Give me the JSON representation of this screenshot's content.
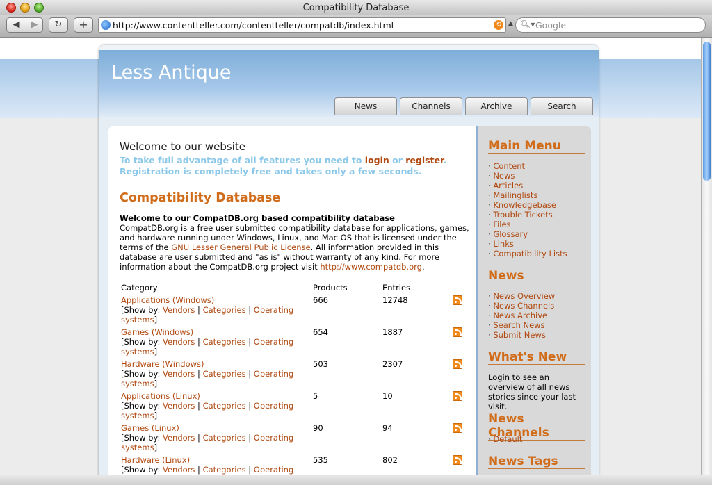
{
  "window": {
    "title": "Compatibility Database"
  },
  "toolbar": {
    "back_label": "◀",
    "forward_label": "▶",
    "reload_label": "↻",
    "add_label": "+",
    "url": "http://www.contentteller.com/contentteller/compatdb/index.html",
    "search_placeholder": "Google"
  },
  "site": {
    "logo": "Less Antique",
    "tabs": [
      "News",
      "Channels",
      "Archive",
      "Search"
    ]
  },
  "welcome": {
    "heading": "Welcome to our website",
    "line1_pre": "To take full advantage of all features you need to ",
    "login": "login",
    "or": " or ",
    "register": "register",
    "line1_post": ".",
    "line2": "Registration is completely free and takes only a few seconds."
  },
  "compat": {
    "heading": "Compatibility Database",
    "intro_bold": "Welcome to our CompatDB.org based compatibility database",
    "intro_1": "CompatDB.org is a free user submitted compatibility database for applications, games, and hardware running under Windows, Linux, and Mac OS that is licensed under the terms of the ",
    "license_link": "GNU Lesser General Public License",
    "intro_2": ". All information provided in this database are user submitted and \"as is\" without warranty of any kind. For more information about the CompatDB.org project visit ",
    "site_link": "http://www.compatdb.org",
    "intro_3": ".",
    "columns": {
      "category": "Category",
      "products": "Products",
      "entries": "Entries"
    },
    "showby_label": "[Show by: ",
    "showby_vendors": "Vendors",
    "showby_categories": "Categories",
    "showby_os": "Operating systems",
    "showby_close": "]",
    "sep": " | ",
    "rows": [
      {
        "name": "Applications (Windows)",
        "products": "666",
        "entries": "12748"
      },
      {
        "name": "Games (Windows)",
        "products": "654",
        "entries": "1887"
      },
      {
        "name": "Hardware (Windows)",
        "products": "503",
        "entries": "2307"
      },
      {
        "name": "Applications (Linux)",
        "products": "5",
        "entries": "10"
      },
      {
        "name": "Games (Linux)",
        "products": "90",
        "entries": "94"
      },
      {
        "name": "Hardware (Linux)",
        "products": "535",
        "entries": "802"
      }
    ]
  },
  "sidebar": {
    "main_menu": {
      "heading": "Main Menu",
      "items": [
        "Content",
        "News",
        "Articles",
        "Mailinglists",
        "Knowledgebase",
        "Trouble Tickets",
        "Files",
        "Glossary",
        "Links",
        "Compatibility Lists"
      ]
    },
    "news": {
      "heading": "News",
      "items": [
        "News Overview",
        "News Channels",
        "News Archive",
        "Search News",
        "Submit News"
      ]
    },
    "whats_new": {
      "heading": "What's New",
      "text": "Login to see an overview of all news stories since your last visit."
    },
    "news_channels": {
      "heading": "News Channels",
      "items": [
        "Default"
      ]
    },
    "news_tags": {
      "heading": "News Tags"
    }
  }
}
